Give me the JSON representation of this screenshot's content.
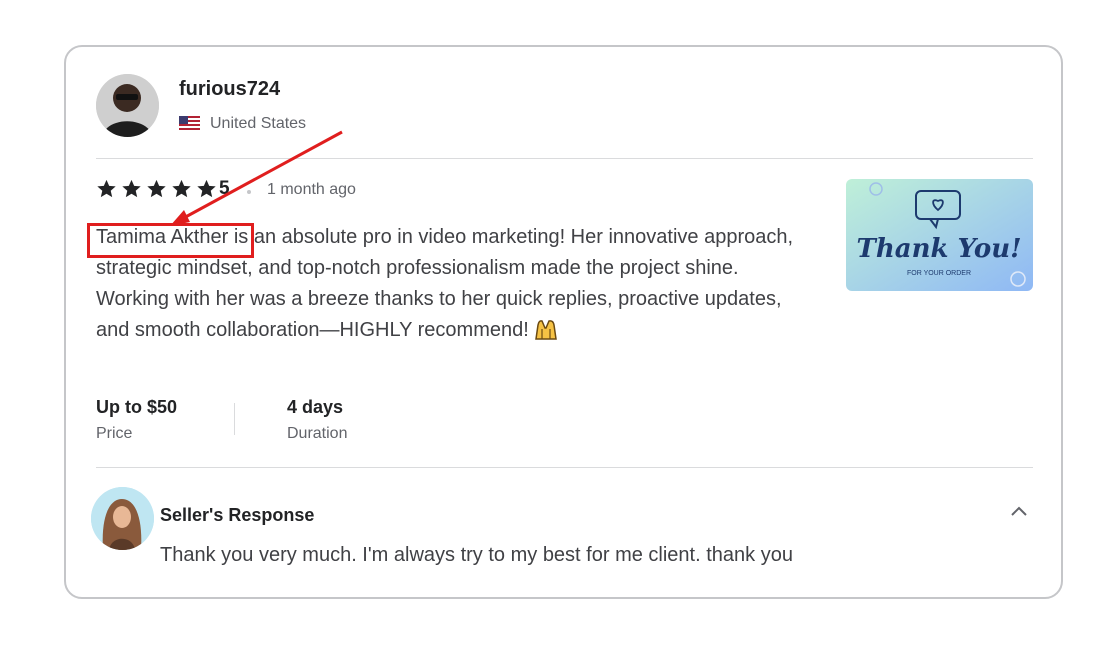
{
  "reviewer": {
    "name": "furious724",
    "country": "United States",
    "flag_icon": "us-flag-icon"
  },
  "rating": {
    "stars": 5,
    "value": "5",
    "time_ago": "1 month ago"
  },
  "review": {
    "highlighted_name": "Tamima Akther",
    "text_after_name": " is an absolute pro in video marketing! Her innovative approach, strategic mindset, and top-notch professionalism made the project shine. Working with her was a breeze thanks to her quick replies, proactive updates, and smooth collaboration—HIGHLY recommend!",
    "emoji_icon": "raised-hands-emoji"
  },
  "thumbnail": {
    "title": "Thank You!",
    "subtitle": "FOR YOUR ORDER"
  },
  "meta": {
    "price_value": "Up to $50",
    "price_label": "Price",
    "duration_value": "4 days",
    "duration_label": "Duration"
  },
  "seller_response": {
    "title": "Seller's Response",
    "text": "Thank you very much. I'm always try to my best for me client. thank you"
  },
  "colors": {
    "star": "#222325",
    "annotation": "#e01e1e",
    "thumb_gradient_start": "#bff0d8",
    "thumb_gradient_end": "#8fb8f5"
  }
}
